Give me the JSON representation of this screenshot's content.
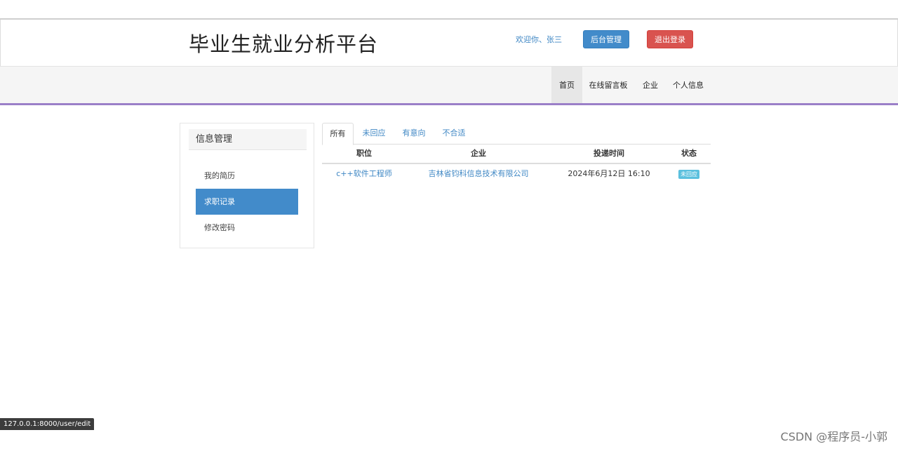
{
  "header": {
    "site_title": "毕业生就业分析平台",
    "welcome": "欢迎你、张三",
    "admin_button": "后台管理",
    "logout_button": "退出登录"
  },
  "nav": {
    "items": [
      {
        "label": "首页",
        "active": true
      },
      {
        "label": "在线留言板"
      },
      {
        "label": "企业"
      },
      {
        "label": "个人信息"
      }
    ]
  },
  "sidebar": {
    "heading": "信息管理",
    "items": [
      {
        "label": "我的简历"
      },
      {
        "label": "求职记录",
        "active": true
      },
      {
        "label": "修改密码"
      }
    ]
  },
  "tabs": [
    {
      "label": "所有",
      "active": true
    },
    {
      "label": "未回应"
    },
    {
      "label": "有意向"
    },
    {
      "label": "不合适"
    }
  ],
  "table": {
    "headers": [
      "职位",
      "企业",
      "投递时间",
      "状态"
    ],
    "rows": [
      {
        "position": "c++软件工程师",
        "company": "吉林省钧科信息技术有限公司",
        "time": "2024年6月12日 16:10",
        "status": "未回应"
      }
    ]
  },
  "status_bar_url": "127.0.0.1:8000/user/edit",
  "watermark": "CSDN @程序员-小郭",
  "colors": {
    "primary": "#428bca",
    "danger": "#d9534f",
    "info_badge": "#5bc0de",
    "nav_accent": "#9b7fc8",
    "link": "#3f87c4"
  }
}
